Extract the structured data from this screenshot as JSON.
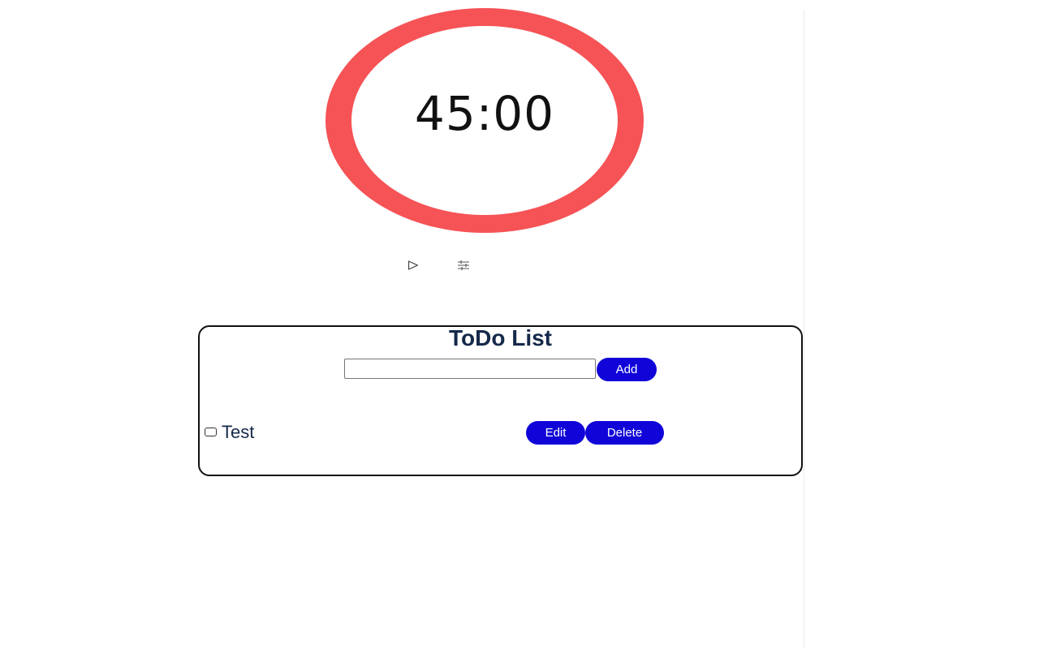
{
  "timer": {
    "time": "45:00",
    "ring_color": "#f55356",
    "controls": [
      {
        "icon": "play-icon"
      },
      {
        "icon": "sliders-icon"
      }
    ]
  },
  "todo": {
    "title": "ToDo List",
    "input_value": "",
    "add_label": "Add",
    "button_color": "#1004d8",
    "items": [
      {
        "text": "Test",
        "checked": false,
        "edit_label": "Edit",
        "delete_label": "Delete"
      }
    ]
  }
}
